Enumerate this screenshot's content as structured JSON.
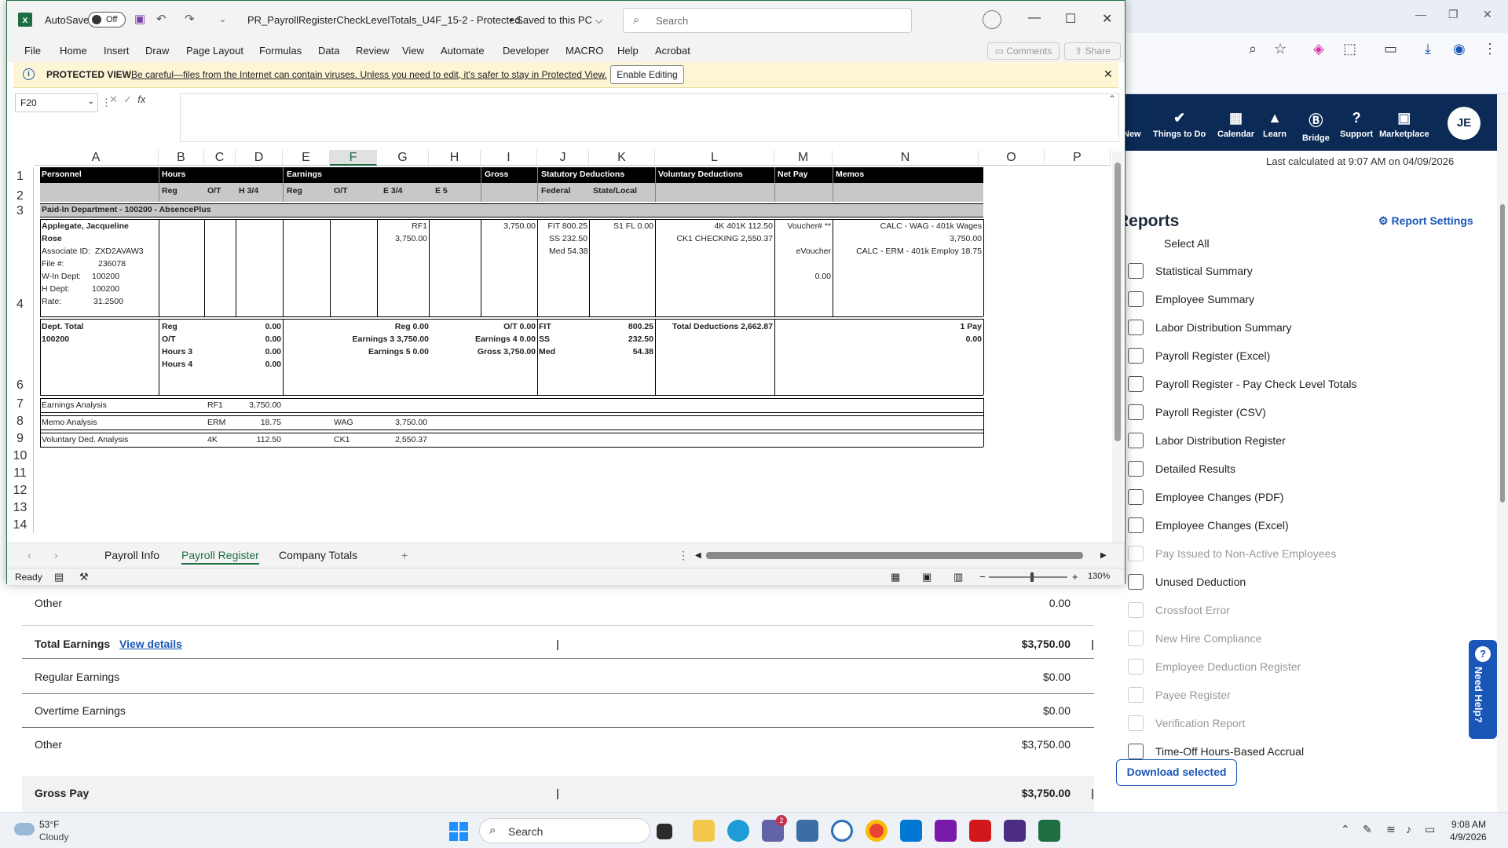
{
  "browser": {
    "nav_items": [
      {
        "label": "New",
        "icon": "plus-icon"
      },
      {
        "label": "Things to Do",
        "icon": "check-icon"
      },
      {
        "label": "Calendar",
        "icon": "calendar-icon"
      },
      {
        "label": "Learn",
        "icon": "graduation-cap-icon"
      },
      {
        "label": "Bridge",
        "icon": "bridge-icon"
      },
      {
        "label": "Support",
        "icon": "question-icon"
      },
      {
        "label": "Marketplace",
        "icon": "bag-icon"
      }
    ],
    "avatar": "JE",
    "last_calculated": "Last calculated at 9:07 AM on 04/09/2026",
    "reports_title": "Reports",
    "report_settings": "Report Settings",
    "select_all": "Select All",
    "reports": [
      {
        "label": "Statistical Summary",
        "disabled": false
      },
      {
        "label": "Employee Summary",
        "disabled": false
      },
      {
        "label": "Labor Distribution Summary",
        "disabled": false
      },
      {
        "label": "Payroll Register (Excel)",
        "disabled": false
      },
      {
        "label": "Payroll Register - Pay Check Level Totals",
        "disabled": false
      },
      {
        "label": "Payroll Register (CSV)",
        "disabled": false
      },
      {
        "label": "Labor Distribution Register",
        "disabled": false
      },
      {
        "label": "Detailed Results",
        "disabled": false
      },
      {
        "label": "Employee Changes (PDF)",
        "disabled": false
      },
      {
        "label": "Employee Changes (Excel)",
        "disabled": false
      },
      {
        "label": "Pay Issued to Non-Active Employees",
        "disabled": true
      },
      {
        "label": "Unused Deduction",
        "disabled": false
      },
      {
        "label": "Crossfoot Error",
        "disabled": true
      },
      {
        "label": "New Hire Compliance",
        "disabled": true
      },
      {
        "label": "Employee Deduction Register",
        "disabled": true
      },
      {
        "label": "Payee Register",
        "disabled": true
      },
      {
        "label": "Verification Report",
        "disabled": true
      },
      {
        "label": "Time-Off Hours-Based Accrual",
        "disabled": false
      }
    ],
    "download_selected": "Download selected",
    "need_help": "Need Help?",
    "summary": {
      "other_top": {
        "label": "Other",
        "value": "0.00"
      },
      "total_earnings": {
        "label": "Total Earnings",
        "link": "View details",
        "value": "$3,750.00"
      },
      "regular": {
        "label": "Regular Earnings",
        "value": "$0.00"
      },
      "overtime": {
        "label": "Overtime Earnings",
        "value": "$0.00"
      },
      "other": {
        "label": "Other",
        "value": "$3,750.00"
      },
      "gross_pay": {
        "label": "Gross Pay",
        "value": "$3,750.00"
      }
    }
  },
  "excel": {
    "autosave_label": "AutoSave",
    "autosave_state": "Off",
    "doc_title": "PR_PayrollRegisterCheckLevelTotals_U4F_15-2  -  Protected...",
    "saved_state": "• Saved to this PC ⌵",
    "search_placeholder": "Search",
    "ribbon_tabs": [
      "File",
      "Home",
      "Insert",
      "Draw",
      "Page Layout",
      "Formulas",
      "Data",
      "Review",
      "View",
      "Automate",
      "Developer",
      "MACRO",
      "Help",
      "Acrobat"
    ],
    "comments": "Comments",
    "share": "Share",
    "protected_title": "PROTECTED VIEW",
    "protected_msg": "Be careful—files from the Internet can contain viruses. Unless you need to edit, it's safer to stay in Protected View.",
    "enable_editing": "Enable Editing",
    "name_box": "F20",
    "columns": [
      "A",
      "B",
      "C",
      "D",
      "E",
      "F",
      "G",
      "H",
      "I",
      "J",
      "K",
      "L",
      "M",
      "N",
      "O",
      "P"
    ],
    "rows": [
      "1",
      "2",
      "3",
      "4",
      "6",
      "7",
      "8",
      "9",
      "10",
      "11",
      "12",
      "13",
      "14"
    ],
    "sheet": {
      "r1": [
        "Personnel",
        "Hours",
        "Earnings",
        "Gross",
        "Statutory Deductions",
        "Voluntary Deductions",
        "Net Pay",
        "Memos"
      ],
      "r2": [
        "Reg",
        "O/T",
        "H 3/4",
        "Reg",
        "O/T",
        "E 3/4",
        "E 5",
        "Federal",
        "State/Local"
      ],
      "r3": "Paid-In Department - 100200 - AbsencePlus",
      "emp_name1": "Applegate,  Jacqueline",
      "emp_name2": "Rose",
      "emp_details": [
        {
          "k": "Associate ID:",
          "v": "ZXD2AVAW3"
        },
        {
          "k": "File #:",
          "v": "236078"
        },
        {
          "k": "W-In Dept:",
          "v": "100200"
        },
        {
          "k": "H Dept:",
          "v": "100200"
        },
        {
          "k": "Rate:",
          "v": "31.2500"
        }
      ],
      "rf1": "RF1",
      "rf1_val": "3,750.00",
      "gross": "3,750.00",
      "fit": "FIT  800.25",
      "ss": "SS  232.50",
      "med": "Med  54.38",
      "state": "S1  FL  0.00",
      "vol1": "4K 401K   112.50",
      "vol2": "CK1 CHECKING   2,550.37",
      "voucher": "Voucher# **",
      "evoucher": "eVoucher",
      "net": "0.00",
      "memo1": "CALC - WAG - 401k Wages",
      "memo1v": "3,750.00",
      "memo2": "CALC - ERM - 401k Employ   18.75",
      "dept_total": "Dept. Total",
      "dept_code": "100200",
      "hours_labels": [
        "Reg",
        "O/T",
        "Hours 3",
        "Hours 4"
      ],
      "hours_vals": [
        "0.00",
        "0.00",
        "0.00",
        "0.00"
      ],
      "earn_a": [
        "Reg   0.00",
        "Earnings 3   3,750.00",
        "Earnings 5   0.00"
      ],
      "earn_b": [
        "O/T   0.00",
        "Earnings 4   0.00",
        "Gross   3,750.00"
      ],
      "stat_labels": [
        "FIT",
        "SS",
        "Med"
      ],
      "stat_vals": [
        "800.25",
        "232.50",
        "54.38"
      ],
      "total_ded": "Total Deductions 2,662.87",
      "pay_count": "1 Pay",
      "pay_amt": "0.00",
      "r7": [
        "Earnings Analysis",
        "RF1",
        "3,750.00"
      ],
      "r8": [
        "Memo Analysis",
        "ERM",
        "18.75",
        "WAG",
        "3,750.00"
      ],
      "r9": [
        "Voluntary Ded. Analysis",
        "4K",
        "112.50",
        "CK1",
        "2,550.37"
      ]
    },
    "sheet_tabs": [
      "Payroll Info",
      "Payroll Register",
      "Company Totals"
    ],
    "status": "Ready",
    "zoom": "130%"
  },
  "taskbar": {
    "temp": "53°F",
    "condition": "Cloudy",
    "search": "Search",
    "time": "9:08 AM",
    "date": "4/9/2026",
    "teams_badge": "2"
  }
}
